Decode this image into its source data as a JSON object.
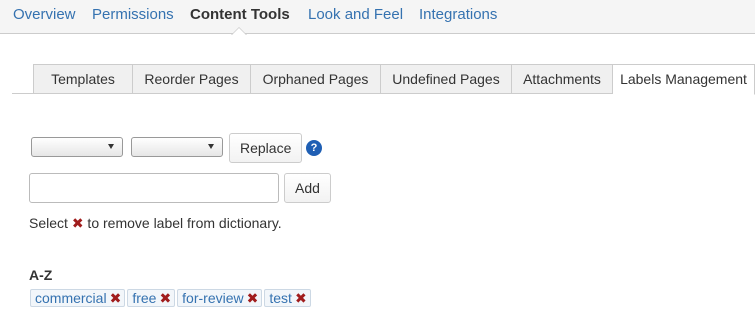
{
  "topnav": {
    "items": [
      {
        "label": "Overview"
      },
      {
        "label": "Permissions"
      },
      {
        "label": "Content Tools"
      },
      {
        "label": "Look and Feel"
      },
      {
        "label": "Integrations"
      }
    ],
    "active": "Content Tools"
  },
  "subtabs": {
    "items": [
      {
        "label": "Templates"
      },
      {
        "label": "Reorder Pages"
      },
      {
        "label": "Orphaned Pages"
      },
      {
        "label": "Undefined Pages"
      },
      {
        "label": "Attachments"
      },
      {
        "label": "Labels Management"
      }
    ],
    "active": "Labels Management"
  },
  "replace": {
    "from_value": "",
    "to_value": "",
    "button_label": "Replace",
    "help_icon": "help-icon",
    "help_glyph": "?"
  },
  "add": {
    "input_value": "",
    "button_label": "Add"
  },
  "hint": {
    "before": "Select ",
    "icon_glyph": "✖",
    "after": " to remove label from dictionary."
  },
  "labels_section": {
    "title": "A-Z",
    "remove_glyph": "✖",
    "labels": [
      {
        "name": "commercial"
      },
      {
        "name": "free"
      },
      {
        "name": "for-review"
      },
      {
        "name": "test"
      }
    ]
  },
  "colors": {
    "link": "#3572b0",
    "remove": "#a01c1c",
    "help": "#1f5fb4"
  }
}
